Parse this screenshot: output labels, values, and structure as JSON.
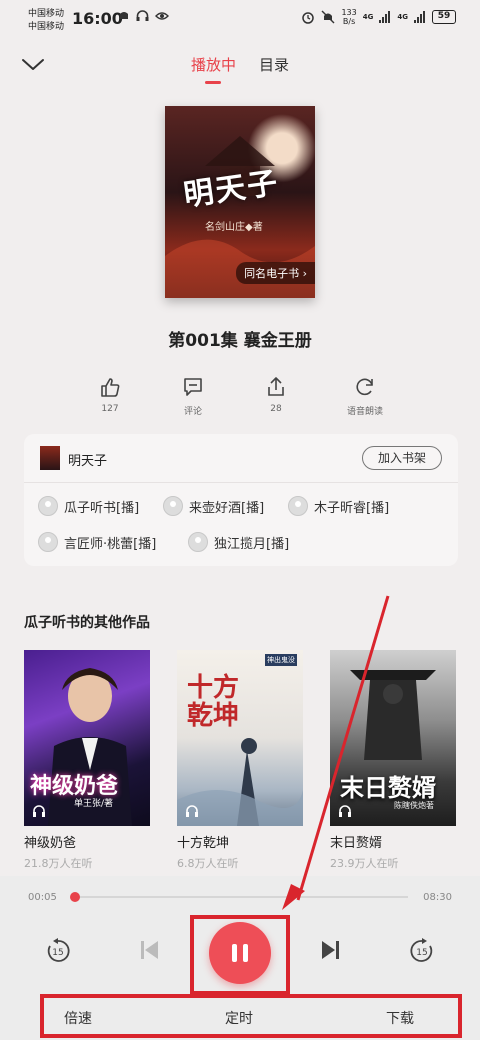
{
  "status_bar": {
    "carrier1": "中国移动",
    "carrier2": "中国移动",
    "time": "16:00",
    "net_speed_top": "133",
    "net_speed_bottom": "B/s",
    "signal1": "4G",
    "signal2": "4G",
    "battery": "59"
  },
  "tabs": {
    "playing": "播放中",
    "catalog": "目录"
  },
  "cover": {
    "title": "明天子",
    "author": "名剑山庄◆著",
    "tag": "同名电子书 ›"
  },
  "episode": {
    "title": "第001集 襄金王册"
  },
  "actions": {
    "like_count": "127",
    "comment": "评论",
    "share_count": "28",
    "tts": "语音朗读"
  },
  "book_card": {
    "name": "明天子",
    "add_shelf": "加入书架",
    "narrators": [
      "瓜子听书[播]",
      "来壶好酒[播]",
      "木子昕睿[播]",
      "言匠师·桃蕾[播]",
      "独江揽月[播]"
    ]
  },
  "other_works": {
    "heading": "瓜子听书的其他作品",
    "items": [
      {
        "name": "神级奶爸",
        "listeners": "21.8万人在听",
        "cover_title": "神级奶爸",
        "cover_sub": "单王张/著"
      },
      {
        "name": "十方乾坤",
        "listeners": "6.8万人在听",
        "cover_title": "十方乾坤",
        "cover_sub": "神出鬼没"
      },
      {
        "name": "末日赘婿",
        "listeners": "23.9万人在听",
        "cover_title": "末日赘婿",
        "cover_sub": "陈瞎佚炮著"
      }
    ]
  },
  "player": {
    "current_time": "00:05",
    "total_time": "08:30",
    "progress": 0.01,
    "rewind_label": "15",
    "forward_label": "15",
    "speed": "倍速",
    "timer": "定时",
    "download": "下载"
  },
  "colors": {
    "accent": "#e8424a",
    "annotation": "#d9252d"
  }
}
